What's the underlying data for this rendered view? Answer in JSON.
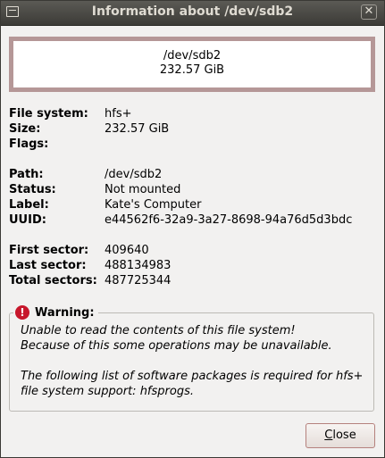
{
  "window": {
    "title": "Information about /dev/sdb2",
    "close_glyph": "✕",
    "menu_icon": "window-menu-icon"
  },
  "device": {
    "path": "/dev/sdb2",
    "size": "232.57 GiB",
    "frame_color": "#b59797"
  },
  "info": {
    "filesystem_label": "File system:",
    "filesystem_value": "hfs+",
    "size_label": "Size:",
    "size_value": "232.57 GiB",
    "flags_label": "Flags:",
    "flags_value": "",
    "path_label": "Path:",
    "path_value": "/dev/sdb2",
    "status_label": "Status:",
    "status_value": "Not mounted",
    "fslabel_label": "Label:",
    "fslabel_value": "Kate's Computer",
    "uuid_label": "UUID:",
    "uuid_value": "e44562f6-32a9-3a27-8698-94a76d5d3bdc",
    "first_sector_label": "First sector:",
    "first_sector_value": "409640",
    "last_sector_label": "Last sector:",
    "last_sector_value": "488134983",
    "total_sectors_label": "Total sectors:",
    "total_sectors_value": "487725344"
  },
  "warning": {
    "icon": "error-icon",
    "icon_glyph": "!",
    "icon_color": "#c7162b",
    "title": "Warning:",
    "line1": "Unable to read the contents of this file system!",
    "line2": "Because of this some operations may be unavailable.",
    "line3": "The following list of software packages is required for hfs+",
    "line4": "file system support:  hfsprogs."
  },
  "buttons": {
    "close_mnemonic": "C",
    "close_rest": "lose"
  }
}
